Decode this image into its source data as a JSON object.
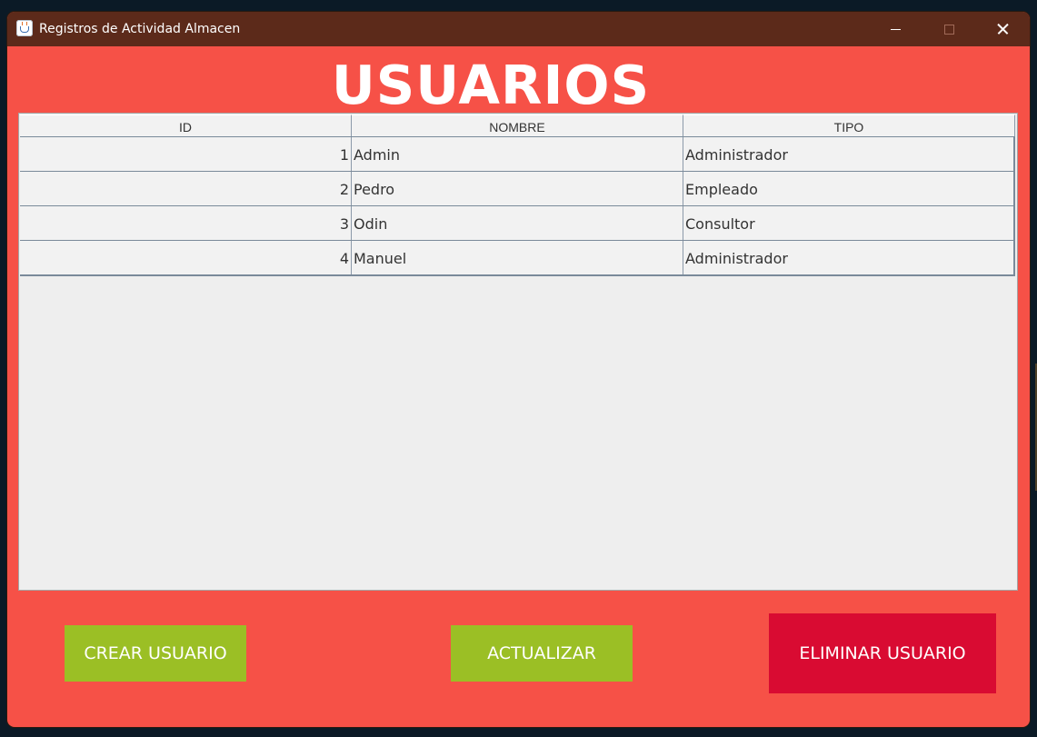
{
  "window": {
    "title": "Registros de Actividad Almacen"
  },
  "page": {
    "heading": "USUARIOS"
  },
  "table": {
    "columns": [
      "ID",
      "NOMBRE",
      "TIPO"
    ],
    "rows": [
      {
        "id": "1",
        "nombre": "Admin",
        "tipo": "Administrador"
      },
      {
        "id": "2",
        "nombre": "Pedro",
        "tipo": "Empleado"
      },
      {
        "id": "3",
        "nombre": "Odin",
        "tipo": "Consultor"
      },
      {
        "id": "4",
        "nombre": "Manuel",
        "tipo": "Administrador"
      }
    ]
  },
  "actions": {
    "crear": "CREAR USUARIO",
    "actualizar": "ACTUALIZAR",
    "eliminar": "ELIMINAR USUARIO"
  },
  "colors": {
    "window_background": "#f65147",
    "titlebar": "#5c2a1a",
    "green_button": "#9bbf25",
    "red_button": "#d90b32"
  },
  "icons": {
    "app": "java-cup-icon",
    "minimize": "minimize-icon",
    "maximize": "maximize-icon",
    "close": "close-icon"
  }
}
